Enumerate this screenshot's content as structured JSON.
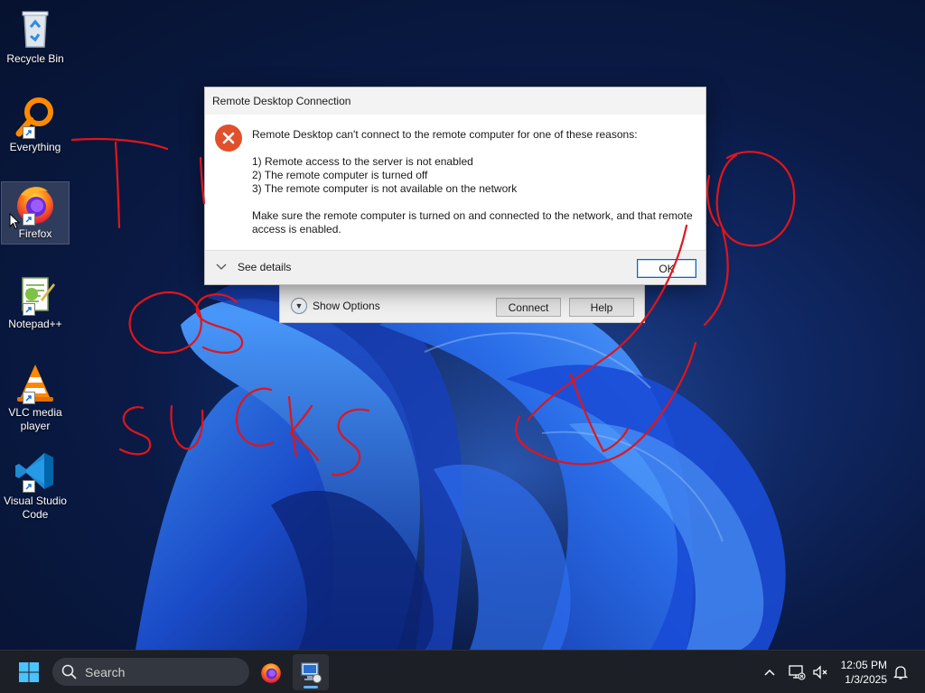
{
  "desktop": {
    "icons": [
      {
        "label": "Recycle Bin",
        "icon": "recycle-bin-icon"
      },
      {
        "label": "Everything",
        "icon": "everything-search-icon"
      },
      {
        "label": "Firefox",
        "icon": "firefox-icon"
      },
      {
        "label": "Notepad++",
        "icon": "notepad-plus-plus-icon"
      },
      {
        "label": "VLC media player",
        "icon": "vlc-icon"
      },
      {
        "label": "Visual Studio Code",
        "icon": "vscode-icon"
      }
    ]
  },
  "rdp_window": {
    "show_options_label": "Show Options",
    "connect_label": "Connect",
    "help_label": "Help"
  },
  "dialog": {
    "title": "Remote Desktop Connection",
    "message": "Remote Desktop can't connect to the remote computer for one of these reasons:",
    "reasons": [
      "1) Remote access to the server is not enabled",
      "2) The remote computer is turned off",
      "3) The remote computer is not available on the network"
    ],
    "advice": "Make sure the remote computer is turned on and connected to the network, and that remote access is enabled.",
    "see_details_label": "See details",
    "ok_label": "OK",
    "icon": "error-icon"
  },
  "annotation": {
    "text": "TIOS OS SUCKS",
    "color": "#e0151b"
  },
  "taskbar": {
    "search_placeholder": "Search",
    "apps": [
      "firefox-icon",
      "remote-desktop-icon"
    ],
    "time": "12:05 PM",
    "date": "1/3/2025"
  },
  "colors": {
    "accent": "#0067c0",
    "error": "#e0502b",
    "taskbar_bg": "#1c1f26"
  }
}
